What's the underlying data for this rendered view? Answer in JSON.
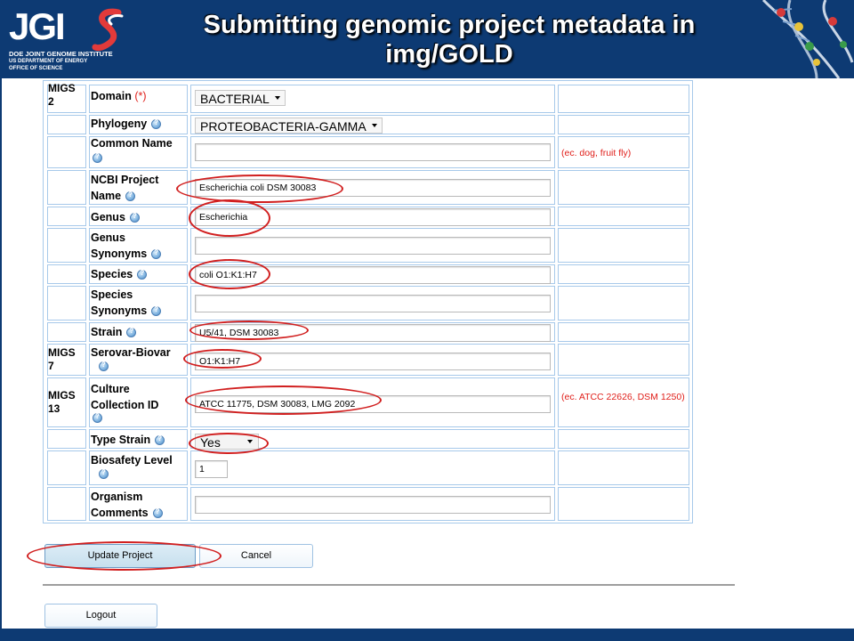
{
  "header": {
    "title": "Submitting genomic project metadata in img/GOLD",
    "logo": {
      "wordmark": "JGI",
      "line1": "DOE JOINT GENOME INSTITUTE",
      "line2": "US DEPARTMENT OF ENERGY",
      "line3": "OFFICE OF SCIENCE"
    },
    "colors": {
      "banner": "#0d3a73",
      "logo_accent": "#e23a3a"
    }
  },
  "form": {
    "rows": [
      {
        "migs": "MIGS\n2",
        "label": "Domain",
        "required_mark": "(*)",
        "kind": "select",
        "value": "BACTERIAL",
        "example": ""
      },
      {
        "migs": "",
        "label": "Phylogeny",
        "kind": "select",
        "value": "PROTEOBACTERIA-GAMMA",
        "example": ""
      },
      {
        "migs": "",
        "label": "Common Name",
        "kind": "input",
        "value": "",
        "example": "(ec. dog, fruit fly)"
      },
      {
        "migs": "",
        "label": "NCBI Project Name",
        "kind": "input",
        "value": "Escherichia coli DSM 30083",
        "example": ""
      },
      {
        "migs": "",
        "label": "Genus",
        "kind": "input",
        "value": "Escherichia",
        "example": ""
      },
      {
        "migs": "",
        "label": "Genus Synonyms",
        "kind": "input",
        "value": "",
        "example": ""
      },
      {
        "migs": "",
        "label": "Species",
        "kind": "input",
        "value": "coli O1:K1:H7",
        "example": ""
      },
      {
        "migs": "",
        "label": "Species Synonyms",
        "kind": "input",
        "value": "",
        "example": ""
      },
      {
        "migs": "",
        "label": "Strain",
        "kind": "input",
        "value": "U5/41, DSM 30083",
        "example": ""
      },
      {
        "migs": "MIGS\n7",
        "label": "Serovar-Biovar",
        "kind": "input",
        "value": "O1:K1:H7",
        "example": ""
      },
      {
        "migs": "MIGS\n13",
        "label": "Culture Collection ID",
        "kind": "input",
        "value": "ATCC 11775, DSM 30083, LMG 2092",
        "example": "(ec. ATCC 22626, DSM 1250)"
      },
      {
        "migs": "",
        "label": "Type Strain",
        "kind": "select",
        "value": "Yes",
        "example": ""
      },
      {
        "migs": "",
        "label": "Biosafety Level",
        "kind": "input",
        "value": "1",
        "example": ""
      },
      {
        "migs": "",
        "label": "Organism Comments",
        "kind": "input",
        "value": "",
        "example": ""
      }
    ],
    "required_color": "#e0201b"
  },
  "buttons": {
    "update": "Update Project",
    "cancel": "Cancel",
    "logout": "Logout"
  },
  "icons": {
    "help": "help-question-icon",
    "dropdown": "dropdown-caret-icon",
    "dna": "dna-helix-icon"
  },
  "annotation_color": "#d11f1f"
}
